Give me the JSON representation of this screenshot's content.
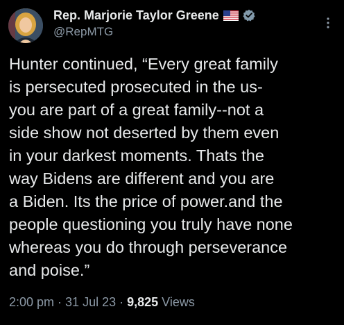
{
  "author": {
    "name": "Rep. Marjorie Taylor Greene",
    "handle": "@RepMTG",
    "flag_icon": "us-flag-icon",
    "verified_icon": "verified-badge-icon",
    "verified_color": "#829aab"
  },
  "tweet": {
    "text": "Hunter continued, “Every great family\nis persecuted prosecuted in the us-\nyou are part of a great family--not a\nside show not deserted by them even\nin your darkest moments. Thats the\nway Bidens are different and you are\na Biden. Its the price of power.and the\npeople questioning you truly have none\nwhereas you do through perseverance\nand poise.”"
  },
  "meta": {
    "time": "2:00 pm",
    "separator": "·",
    "date": "31 Jul 23",
    "views_count": "9,825",
    "views_label": "Views"
  },
  "colors": {
    "background": "#000000",
    "text": "#e7e9ea",
    "secondary": "#8b98a5"
  }
}
